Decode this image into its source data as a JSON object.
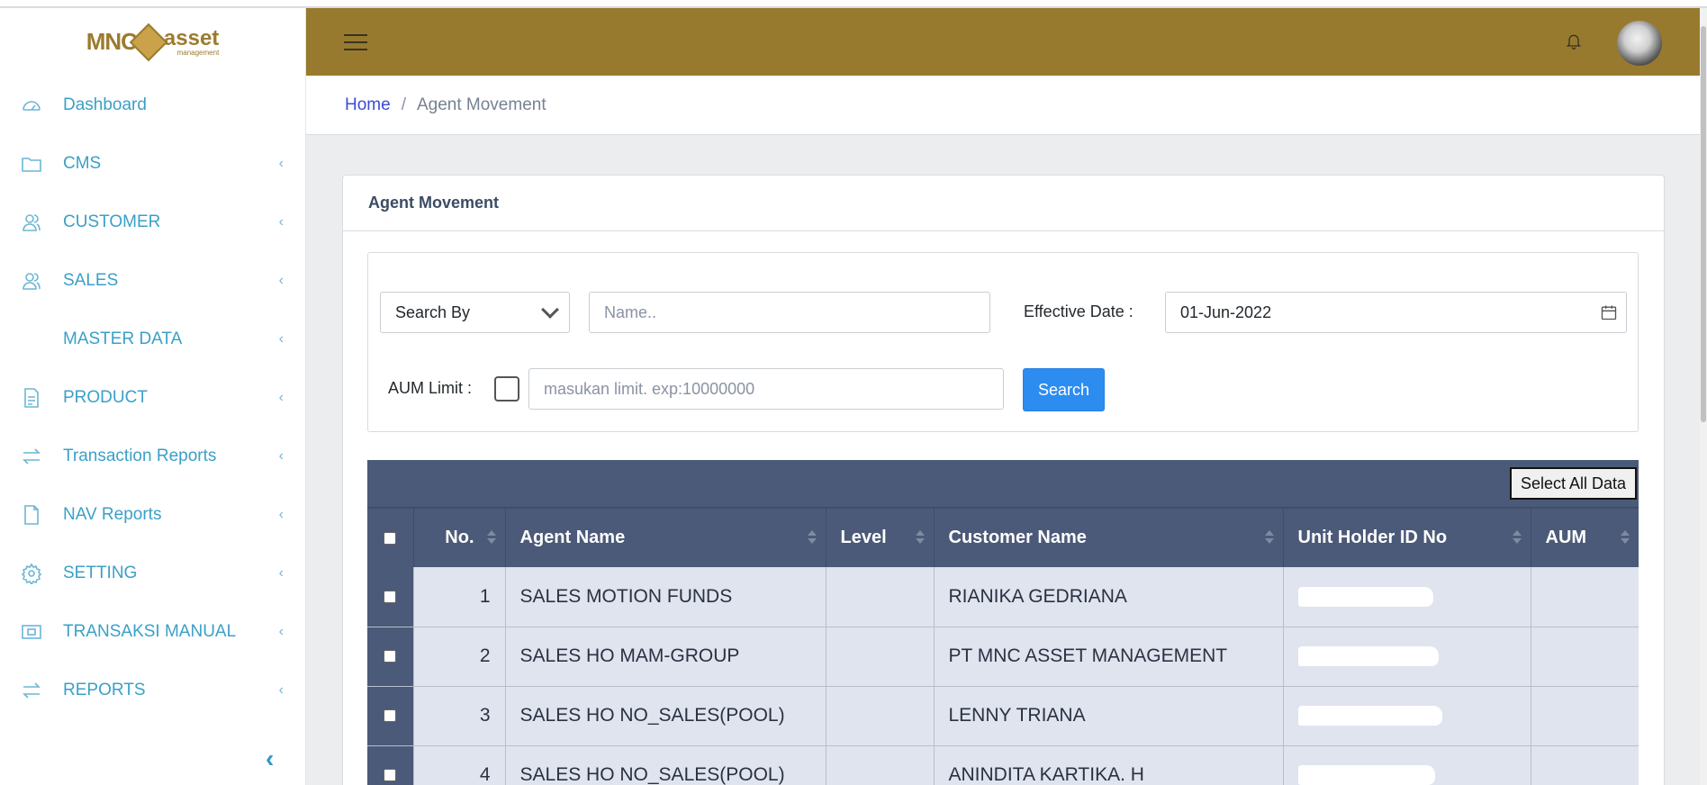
{
  "brand": {
    "logo_left": "MNC",
    "logo_right": "asset",
    "logo_sub": "management"
  },
  "sidebar": {
    "items": [
      {
        "label": "Dashboard",
        "icon": "speedometer-icon",
        "has_chevron": false
      },
      {
        "label": "CMS",
        "icon": "folder-icon",
        "has_chevron": true
      },
      {
        "label": "CUSTOMER",
        "icon": "users-icon",
        "has_chevron": true
      },
      {
        "label": "SALES",
        "icon": "users-icon",
        "has_chevron": true
      },
      {
        "label": "MASTER DATA",
        "icon": "",
        "has_chevron": true
      },
      {
        "label": "PRODUCT",
        "icon": "document-icon",
        "has_chevron": true
      },
      {
        "label": "Transaction Reports",
        "icon": "swap-icon",
        "has_chevron": true
      },
      {
        "label": "NAV Reports",
        "icon": "file-icon",
        "has_chevron": true
      },
      {
        "label": "SETTING",
        "icon": "gear-icon",
        "has_chevron": true
      },
      {
        "label": "TRANSAKSI MANUAL",
        "icon": "money-icon",
        "has_chevron": true
      },
      {
        "label": "REPORTS",
        "icon": "swap-icon",
        "has_chevron": true
      }
    ],
    "chevron": "‹",
    "collapse": "‹"
  },
  "breadcrumb": {
    "home": "Home",
    "separator": "/",
    "current": "Agent Movement"
  },
  "card": {
    "title": "Agent Movement"
  },
  "filter": {
    "search_by": "Search By",
    "name_placeholder": "Name..",
    "effective_date_label": "Effective Date :",
    "effective_date": "01-Jun-2022",
    "aum_limit_label": "AUM Limit :",
    "aum_placeholder": "masukan limit. exp:10000000",
    "search_button": "Search"
  },
  "table": {
    "select_all": "Select All Data",
    "columns": [
      "No.",
      "Agent Name",
      "Level",
      "Customer Name",
      "Unit Holder ID No",
      "AUM"
    ],
    "rows": [
      {
        "no": "1",
        "agent": "SALES MOTION FUNDS",
        "level": "",
        "customer": "RIANIKA GEDRIANA",
        "aum": ""
      },
      {
        "no": "2",
        "agent": "SALES HO MAM-GROUP",
        "level": "",
        "customer": "PT MNC ASSET MANAGEMENT",
        "aum": ""
      },
      {
        "no": "3",
        "agent": "SALES HO NO_SALES(POOL)",
        "level": "",
        "customer": "LENNY TRIANA",
        "aum": ""
      },
      {
        "no": "4",
        "agent": "SALES HO NO_SALES(POOL)",
        "level": "",
        "customer": "ANINDITA KARTIKA. H",
        "aum": ""
      }
    ]
  },
  "colors": {
    "header_bg": "#987a2f",
    "table_header_bg": "#4b5a78",
    "nav_text": "#3aa0c8",
    "primary_button": "#2d8cf0"
  }
}
